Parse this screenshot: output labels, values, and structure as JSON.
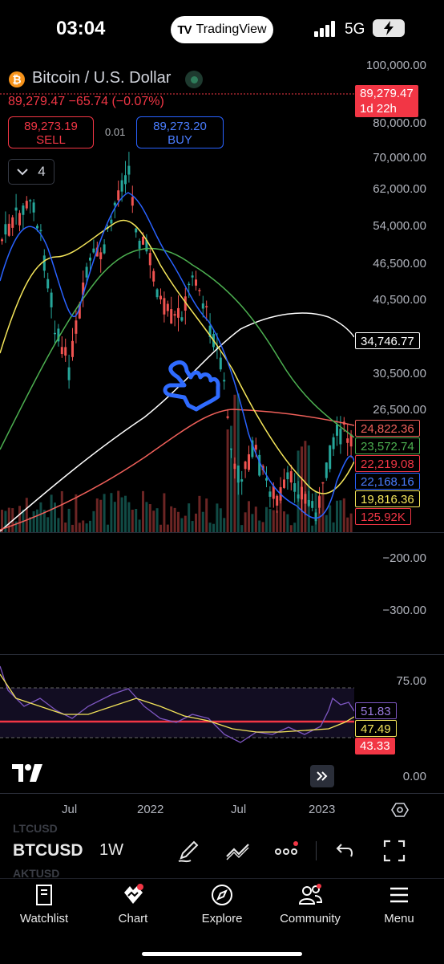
{
  "status_bar": {
    "time": "03:04",
    "app_pill": "TradingView",
    "pill_logo": "TV",
    "network": "5G"
  },
  "symbol_header": {
    "title": "Bitcoin / U.S. Dollar",
    "price_line": "89,279.47 −65.74 (−0.07%)",
    "sell": {
      "price": "89,273.19",
      "label": "SELL"
    },
    "buy": {
      "price": "89,273.20",
      "label": "BUY"
    },
    "spread": "0.01",
    "indicators_count": "4"
  },
  "price_axis": {
    "labels": [
      "100,000.00",
      "80,000.00",
      "70,000.00",
      "62,000.00",
      "54,000.00",
      "46,500.00",
      "40,500.00",
      "30,500.00",
      "26,500.00",
      "−200.00",
      "−300.00"
    ],
    "current_price_tag": {
      "price": "89,279.47",
      "countdown": "1d 22h",
      "color": "#f23645"
    },
    "ma_tags": [
      {
        "value": "34,746.77",
        "color": "#ffffff"
      },
      {
        "value": "24,822.36",
        "color": "#f0605a"
      },
      {
        "value": "23,572.74",
        "color": "#4caf50"
      },
      {
        "value": "22,219.08",
        "color": "#f23645"
      },
      {
        "value": "22,168.16",
        "color": "#2962ff"
      },
      {
        "value": "19,816.36",
        "color": "#f5e65a"
      },
      {
        "value": "125.92K",
        "color": "#f23645"
      }
    ]
  },
  "rsi_pane": {
    "axis_labels": [
      "75.00",
      "0.00"
    ],
    "tags": [
      {
        "value": "51.83",
        "color": "#7e57c2"
      },
      {
        "value": "47.49",
        "color": "#f5e65a"
      },
      {
        "value": "43.33",
        "color": "#f23645"
      }
    ]
  },
  "time_axis": [
    "Jul",
    "2022",
    "Jul",
    "2023"
  ],
  "toolbar": {
    "watchlist_symbols": [
      "LTCUSD",
      "AKTUSD"
    ],
    "symbol": "BTCUSD",
    "interval": "1W",
    "icons": [
      "pen-icon",
      "trendline-icon",
      "more-icon",
      "undo-icon",
      "fullscreen-icon"
    ]
  },
  "nav": [
    {
      "label": "Watchlist",
      "icon": "book-icon"
    },
    {
      "label": "Chart",
      "icon": "chart-icon"
    },
    {
      "label": "Explore",
      "icon": "compass-icon"
    },
    {
      "label": "Community",
      "icon": "people-icon"
    },
    {
      "label": "Menu",
      "icon": "hamburger-icon"
    }
  ],
  "colors": {
    "up": "#26a69a",
    "down": "#ef5350",
    "accent_red": "#f23645",
    "accent_blue": "#2962ff",
    "hand_annotation": "#2f6bff"
  }
}
